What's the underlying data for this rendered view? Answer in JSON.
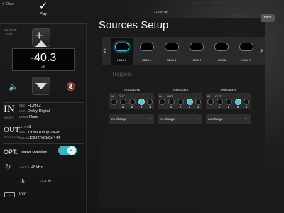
{
  "left": {
    "close_label": "Close",
    "play_label": "Play",
    "master_label": "MASTER LEVEL",
    "volume_value": "-40.3",
    "volume_unit": "dB",
    "input": {
      "big": "IN",
      "sub": "SOURCE",
      "src_key": "SRC:",
      "src_val": "HDMI 2",
      "fmt_key": "FMT:",
      "fmt_val": "Dolby Digital",
      "upmix_key": "UPMIX:",
      "upmix_val": "None"
    },
    "output": {
      "big": "OUT",
      "sub": "RESOLUTION",
      "output_key": "OUTPUT:",
      "output_val": "2",
      "res_key": "RES:",
      "res_val": "1920x1080p 24Hz",
      "color_key": "COLOR:",
      "color_val": "12BIT/YCbCr/444"
    },
    "opt_big": "OPT.",
    "opt_label": "Trinnov Optimizer",
    "opt_enabled": true,
    "clock_key": "CLOCK:",
    "clock_val": "48 kHz",
    "eq_key": "EQ:",
    "eq_val": "ON",
    "info_label": "Info"
  },
  "right": {
    "fold_label": "Fold up",
    "title": "Sources Setup",
    "back_label": "Back",
    "sources": [
      {
        "label": "HDMI 2",
        "active": true
      },
      {
        "label": "HDMI 3",
        "active": false
      },
      {
        "label": "HDMI 4",
        "active": false
      },
      {
        "label": "HDMI 5",
        "active": false
      },
      {
        "label": "HDMI 6",
        "active": false
      },
      {
        "label": "HDMI 7",
        "active": false
      }
    ],
    "triggers_title": "Triggers",
    "triggers": [
      {
        "title": "TRIGGERS",
        "in_label": "IN",
        "out_label": "OUT",
        "numbers": [
          "1",
          "2",
          "3",
          "4"
        ],
        "active": [
          2
        ],
        "select": "no change"
      },
      {
        "title": "TRIGGERS",
        "in_label": "IN",
        "out_label": "OUT",
        "numbers": [
          "1",
          "2",
          "3",
          "4"
        ],
        "active": [
          2
        ],
        "select": "no change"
      },
      {
        "title": "TRIGGERS",
        "in_label": "IN",
        "out_label": "OUT",
        "numbers": [
          "1",
          "2",
          "3",
          "4"
        ],
        "active": [
          2
        ],
        "select": "no change"
      }
    ]
  }
}
